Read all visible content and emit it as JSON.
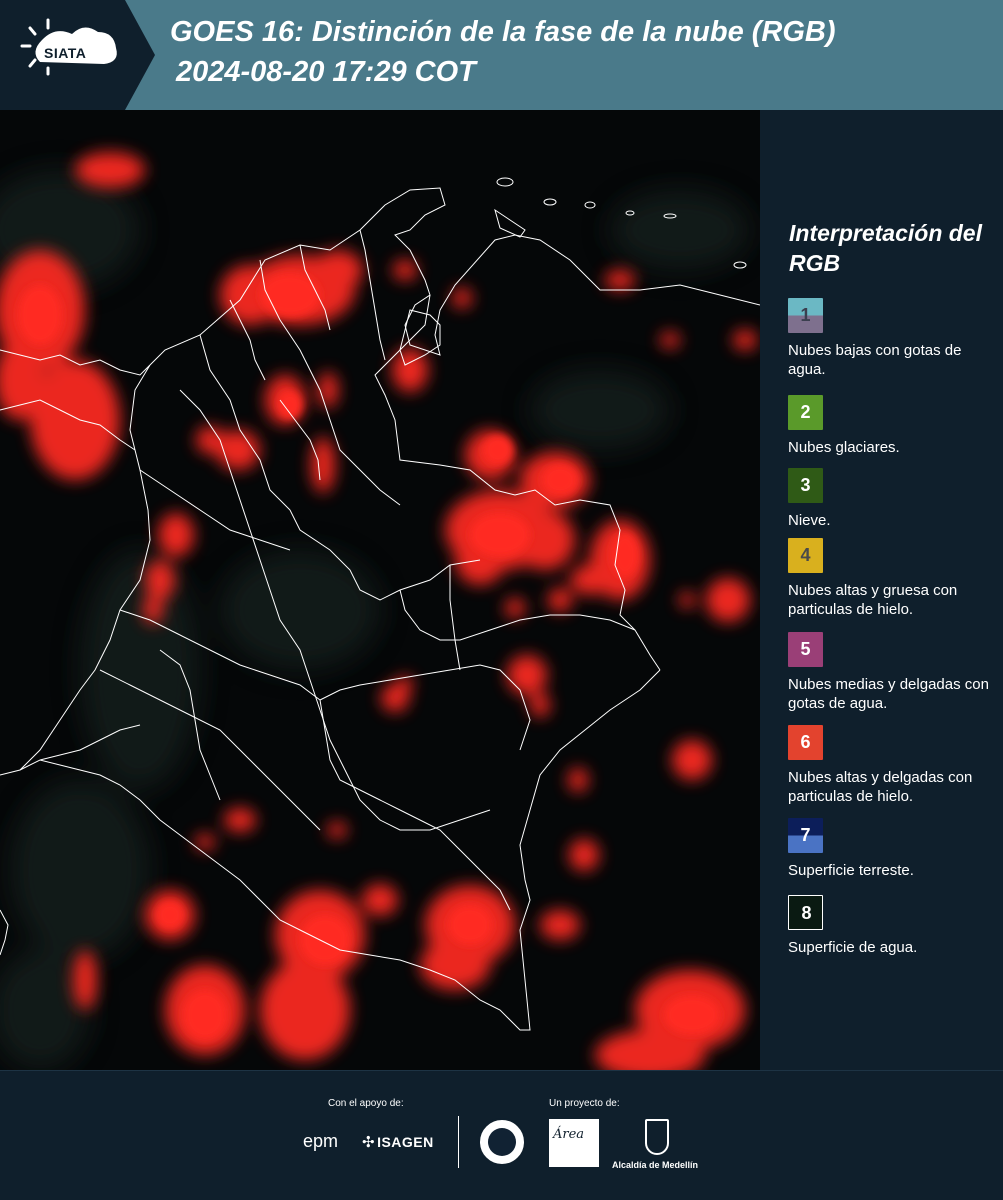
{
  "header": {
    "logo_text": "SIATA",
    "title_line1": "GOES 16: Distinción de la fase de la nube (RGB)",
    "title_line2": "2024-08-20 17:29 COT",
    "background_color": "#4a7a8a"
  },
  "legend": {
    "title": "Interpretación del RGB",
    "items": [
      {
        "number": "1",
        "description": "Nubes bajas con gotas de agua.",
        "color_top": "#6bb8c4",
        "color_bottom": "#7e708e",
        "number_color": "#3b3f4f"
      },
      {
        "number": "2",
        "description": "Nubes glaciares.",
        "color_top": "#5a9a2a",
        "color_bottom": "#5a9a2a",
        "number_color": "#ffffff"
      },
      {
        "number": "3",
        "description": "Nieve.",
        "color_top": "#2f5a16",
        "color_bottom": "#2f5a16",
        "number_color": "#ffffff"
      },
      {
        "number": "4",
        "description": "Nubes altas y gruesa con particulas de hielo.",
        "color_top": "#d9b01e",
        "color_bottom": "#d9b01e",
        "number_color": "#4a4a4a"
      },
      {
        "number": "5",
        "description": "Nubes medias y delgadas con gotas de agua.",
        "color_top": "#9a3f77",
        "color_bottom": "#9a3f77",
        "number_color": "#ffffff"
      },
      {
        "number": "6",
        "description": "Nubes altas y delgadas con particulas de hielo.",
        "color_top": "#e3432e",
        "color_bottom": "#e3432e",
        "number_color": "#ffffff"
      },
      {
        "number": "7",
        "description": "Superficie terreste.",
        "color_top": "#0c1e5a",
        "color_bottom": "#4a73c4",
        "number_color": "#ffffff"
      },
      {
        "number": "8",
        "description": "Superficie de agua.",
        "color_top": "#0a1a12",
        "color_bottom": "#0a1a12",
        "number_color": "#ffffff"
      }
    ]
  },
  "footer": {
    "support_caption": "Con el apoyo de:",
    "project_caption": "Un proyecto de:",
    "epm_logo": "epm",
    "isagen_logo": "ISAGEN",
    "area_logo": "Área",
    "alcaldia_logo": "Alcaldía de Medellín"
  },
  "map": {
    "cloud_color": "#ff2a20",
    "border_color": "#ffffff",
    "background_color": "#050708"
  }
}
